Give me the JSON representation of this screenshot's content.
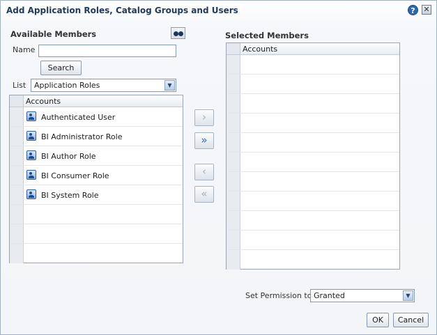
{
  "dialog": {
    "title": "Add Application Roles, Catalog Groups and Users",
    "help_icon": "?",
    "close_icon": "✕"
  },
  "available": {
    "heading": "Available Members",
    "search_icon": "binoculars-icon",
    "name_label": "Name",
    "name_value": "",
    "search_button": "Search",
    "list_label": "List",
    "list_value": "Application Roles",
    "column_header": "Accounts",
    "rows": [
      {
        "label": "Authenticated User",
        "icon": "application-role-icon"
      },
      {
        "label": "BI Administrator Role",
        "icon": "application-role-icon"
      },
      {
        "label": "BI Author Role",
        "icon": "application-role-icon"
      },
      {
        "label": "BI Consumer Role",
        "icon": "application-role-icon"
      },
      {
        "label": "BI System Role",
        "icon": "application-role-icon"
      }
    ]
  },
  "shuttle": {
    "move": "›",
    "move_all": "»",
    "remove": "‹",
    "remove_all": "«"
  },
  "selected": {
    "heading": "Selected Members",
    "column_header": "Accounts"
  },
  "permission": {
    "label": "Set Permission to",
    "value": "Granted"
  },
  "footer": {
    "ok_label": "OK",
    "cancel_label": "Cancel"
  },
  "colors": {
    "title": "#223b5a",
    "accent": "#2e67b2"
  }
}
